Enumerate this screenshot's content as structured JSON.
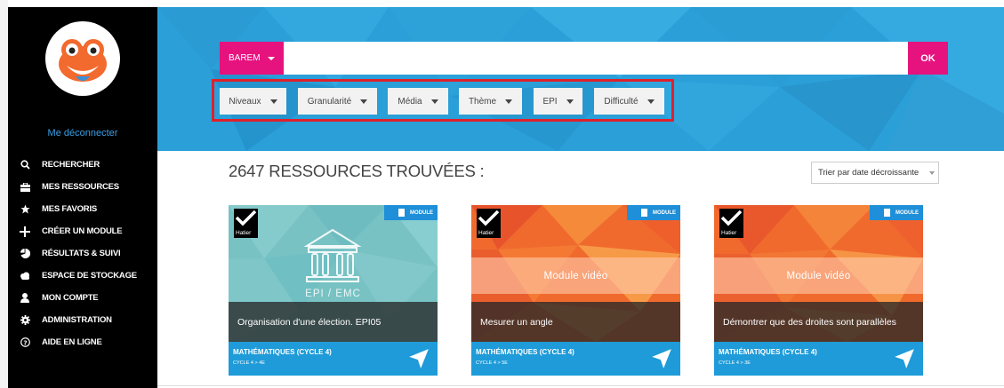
{
  "sidebar": {
    "logout_label": "Me déconnecter",
    "items": [
      {
        "label": "RECHERCHER",
        "icon": "search-icon"
      },
      {
        "label": "MES RESSOURCES",
        "icon": "briefcase-icon"
      },
      {
        "label": "MES FAVORIS",
        "icon": "star-icon"
      },
      {
        "label": "CRÉER UN MODULE",
        "icon": "plus-icon"
      },
      {
        "label": "RÉSULTATS & SUIVI",
        "icon": "pie-chart-icon"
      },
      {
        "label": "ESPACE DE STOCKAGE",
        "icon": "cloud-icon"
      },
      {
        "label": "MON COMPTE",
        "icon": "user-icon"
      },
      {
        "label": "ADMINISTRATION",
        "icon": "gear-icon"
      },
      {
        "label": "AIDE EN LIGNE",
        "icon": "help-icon"
      }
    ]
  },
  "search": {
    "scope_label": "BAREM",
    "placeholder": "",
    "submit_label": "OK"
  },
  "filters": [
    "Niveaux",
    "Granularité",
    "Média",
    "Thème",
    "EPI",
    "Difficulté"
  ],
  "results": {
    "title": "2647 RESSOURCES TROUVÉES :",
    "sort_label": "Trier par date décroissante"
  },
  "cards": [
    {
      "publisher": "Hatier",
      "badge": "MODULE",
      "overlay_text": "EPI / EMC",
      "caption": "Organisation d'une élection. EPI05",
      "subject": "MATHÉMATIQUES (CYCLE 4)",
      "cycle": "CYCLE 4 > 4E"
    },
    {
      "publisher": "Hatier",
      "badge": "MODULE",
      "overlay_text": "Module vidéo",
      "caption": "Mesurer un angle",
      "subject": "MATHÉMATIQUES (CYCLE 4)",
      "cycle": "CYCLE 4 > 5E"
    },
    {
      "publisher": "Hatier",
      "badge": "MODULE",
      "overlay_text": "Module vidéo",
      "caption": "Démontrer que des droites sont parallèles",
      "subject": "MATHÉMATIQUES (CYCLE 4)",
      "cycle": "CYCLE 4 > 3E"
    }
  ],
  "colors": {
    "sidebar_bg": "#000000",
    "hero_bg": "#2a9fd8",
    "accent_pink": "#e6137f",
    "highlight_red": "#e0202a",
    "card_footer": "#1e9bd8",
    "logout_link": "#3aa0e8"
  }
}
